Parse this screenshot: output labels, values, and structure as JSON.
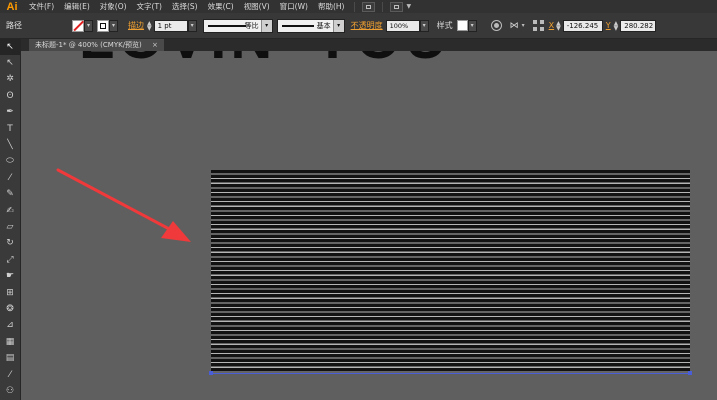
{
  "app": {
    "logo": "Ai"
  },
  "menu": {
    "items": [
      "文件(F)",
      "编辑(E)",
      "对象(O)",
      "文字(T)",
      "选择(S)",
      "效果(C)",
      "视图(V)",
      "窗口(W)",
      "帮助(H)"
    ]
  },
  "control_bar": {
    "object_type": "路径",
    "stroke_label": "描边",
    "stroke_weight": "1 pt",
    "stroke_profile_label": "等比",
    "brush_label": "基本",
    "opacity_label": "不透明度",
    "opacity_value": "100%",
    "style_label": "样式",
    "x_label": "X",
    "x_value": "-126.245",
    "y_label": "Y",
    "y_value": "280.282"
  },
  "document": {
    "tab_title": "未标题-1* @ 400% (CMYK/预览)",
    "close_symbol": "×",
    "artwork_text": "LOVIN' YOU"
  },
  "tools": [
    {
      "name": "selection-tool-icon",
      "glyph": "↖",
      "active": true
    },
    {
      "name": "direct-selection-tool-icon",
      "glyph": "↖"
    },
    {
      "name": "magic-wand-tool-icon",
      "glyph": "✲"
    },
    {
      "name": "lasso-tool-icon",
      "glyph": "ʘ"
    },
    {
      "name": "pen-tool-icon",
      "glyph": "✒"
    },
    {
      "name": "type-tool-icon",
      "glyph": "T"
    },
    {
      "name": "line-segment-tool-icon",
      "glyph": "╲"
    },
    {
      "name": "ellipse-tool-icon",
      "glyph": "⬭"
    },
    {
      "name": "paintbrush-tool-icon",
      "glyph": "⁄"
    },
    {
      "name": "pencil-tool-icon",
      "glyph": "✎"
    },
    {
      "name": "blob-brush-tool-icon",
      "glyph": "✍"
    },
    {
      "name": "eraser-tool-icon",
      "glyph": "▱"
    },
    {
      "name": "rotate-tool-icon",
      "glyph": "↻"
    },
    {
      "name": "scale-tool-icon",
      "glyph": "⤢"
    },
    {
      "name": "warp-tool-icon",
      "glyph": "☛"
    },
    {
      "name": "free-transform-tool-icon",
      "glyph": "⊞"
    },
    {
      "name": "shape-builder-tool-icon",
      "glyph": "❂"
    },
    {
      "name": "perspective-grid-tool-icon",
      "glyph": "⊿"
    },
    {
      "name": "mesh-tool-icon",
      "glyph": "▦"
    },
    {
      "name": "gradient-tool-icon",
      "glyph": "▤"
    },
    {
      "name": "eyedropper-tool-icon",
      "glyph": "⁄"
    },
    {
      "name": "blend-tool-icon",
      "glyph": "⚇"
    }
  ],
  "colors": {
    "accent_orange": "#f0a030",
    "selection_blue": "#4a5ed8",
    "arrow_red": "#f0393a"
  }
}
